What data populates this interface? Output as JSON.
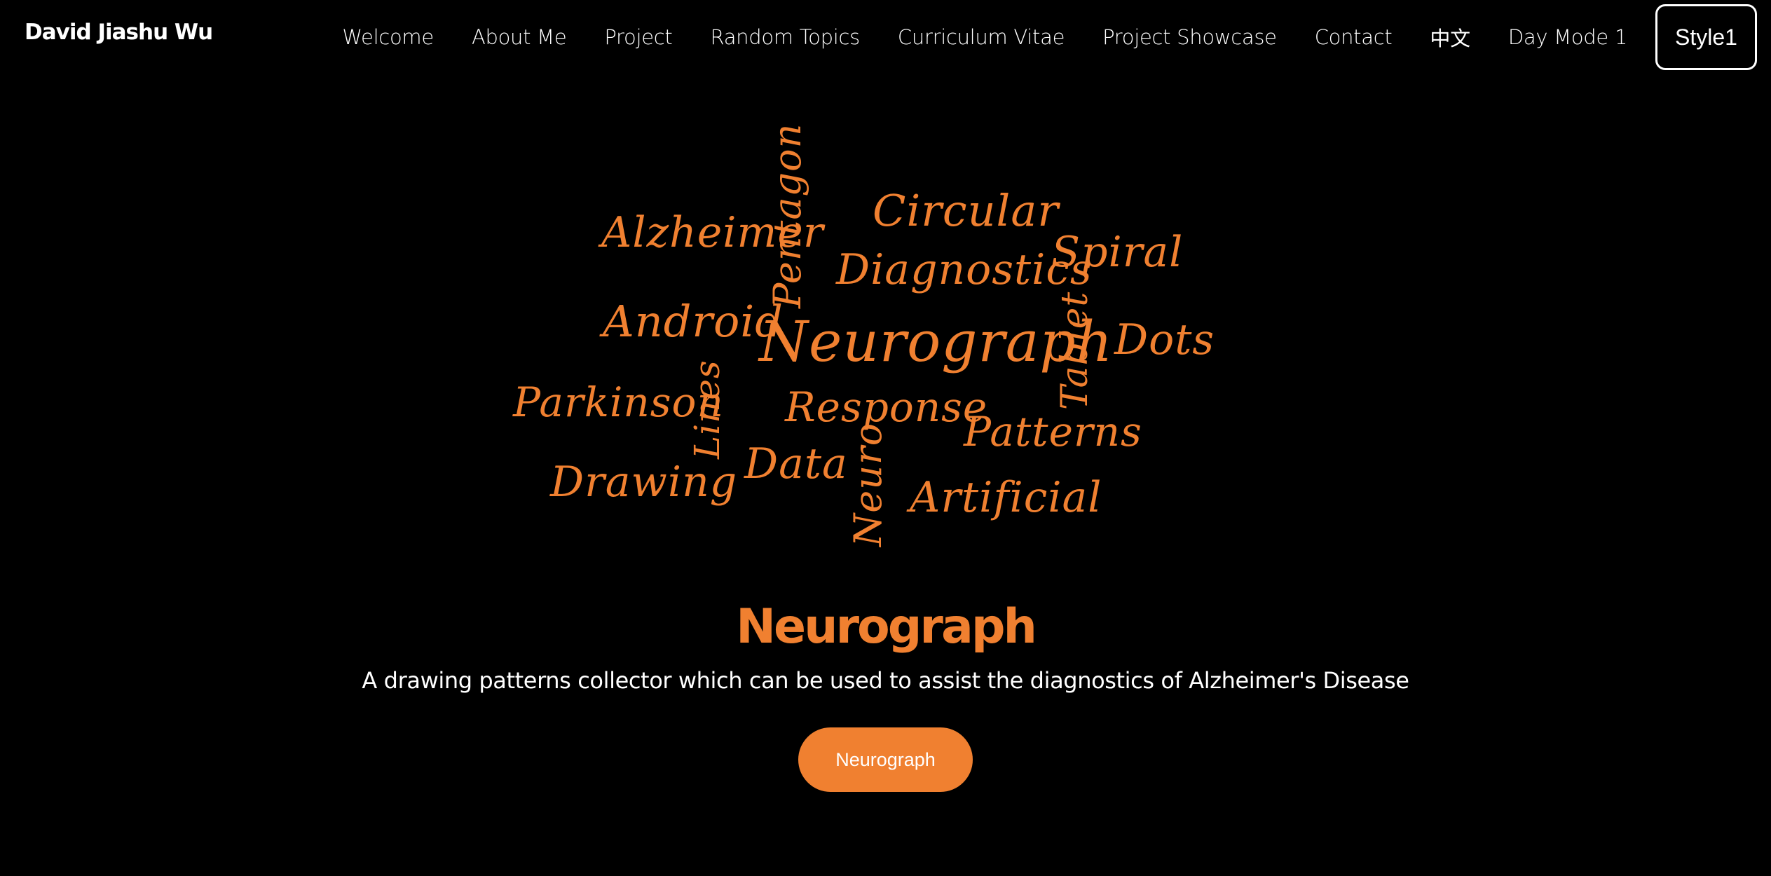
{
  "header": {
    "brand": "David Jiashu Wu",
    "nav": [
      "Welcome",
      "About Me",
      "Project",
      "Random Topics",
      "Curriculum Vitae",
      "Project Showcase",
      "Contact",
      "中文",
      "Day Mode 1"
    ],
    "style_button": "Style1"
  },
  "word_cloud": {
    "words": {
      "circular": "Circular",
      "pentagon": "Pentagon",
      "alzheimer": "Alzheimer",
      "diagnostics": "Diagnostics",
      "spiral": "Spiral",
      "android": "Android",
      "neurograph": "Neurograph",
      "tablet": "Tablet",
      "dots": "Dots",
      "parkinson": "Parkinson",
      "lines": "Lines",
      "response": "Response",
      "patterns": "Patterns",
      "data": "Data",
      "drawing": "Drawing",
      "neuro": "Neuro",
      "artificial": "Artificial"
    },
    "color": "#f08030"
  },
  "hero": {
    "title": "Neurograph",
    "subtitle": "A drawing patterns collector which can be used to assist the diagnostics of Alzheimer's Disease",
    "button_label": "Neurograph",
    "accent_color": "#f08030"
  }
}
